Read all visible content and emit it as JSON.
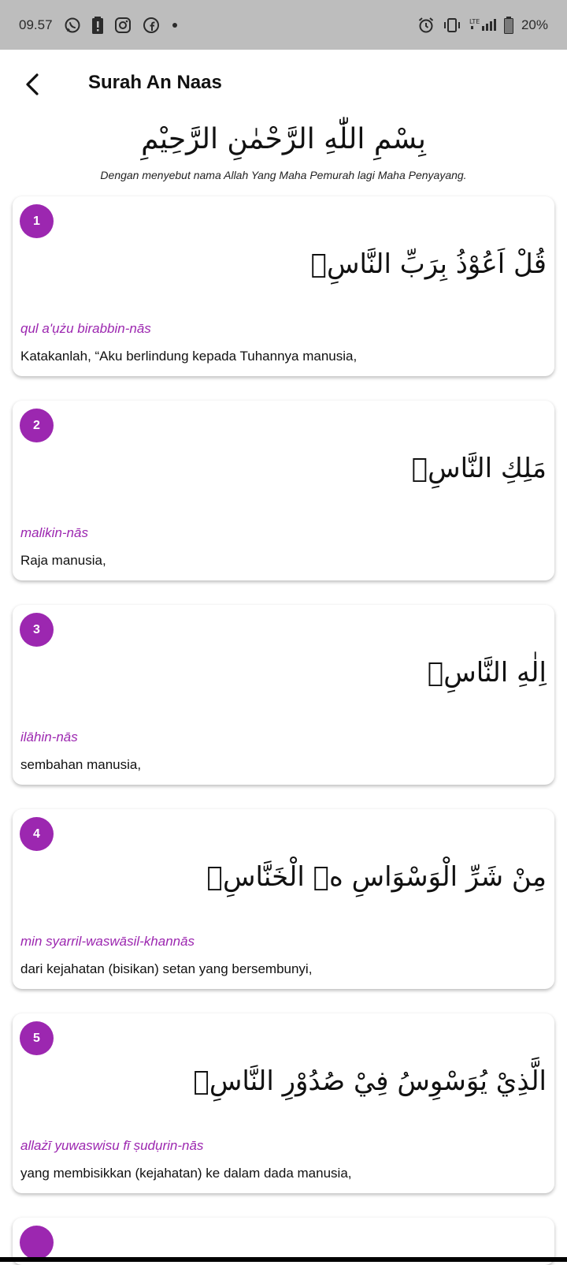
{
  "status_bar": {
    "time": "09.57",
    "battery_percent": "20%",
    "network": "LTE",
    "notification_icons": [
      "whatsapp-icon",
      "battery-alert-icon",
      "instagram-icon",
      "facebook-icon",
      "dot-icon"
    ],
    "system_icons": [
      "alarm-icon",
      "vibrate-icon",
      "signal-icon",
      "battery-icon"
    ]
  },
  "header": {
    "title": "Surah An Naas"
  },
  "bismillah": {
    "arabic": "بِسْمِ اللّٰهِ الرَّحْمٰنِ الرَّحِيْمِ",
    "translation": "Dengan menyebut nama Allah Yang Maha Pemurah lagi Maha Penyayang."
  },
  "verses": [
    {
      "number": "1",
      "arabic": "قُلْ اَعُوْذُ بِرَبِّ النَّاسِۙ",
      "latin": "qul a'ụżu birabbin-nās",
      "translation": "Katakanlah, “Aku berlindung kepada Tuhannya manusia,"
    },
    {
      "number": "2",
      "arabic": "مَلِكِ النَّاسِۙ",
      "latin": "malikin-nās",
      "translation": "Raja manusia,"
    },
    {
      "number": "3",
      "arabic": "اِلٰهِ النَّاسِۙ",
      "latin": "ilāhin-nās",
      "translation": "sembahan manusia,"
    },
    {
      "number": "4",
      "arabic": "مِنْ شَرِّ الْوَسْوَاسِ ەۙ الْخَنَّاسِۖ",
      "latin": "min syarril-waswāsil-khannās",
      "translation": "dari kejahatan (bisikan) setan yang bersembunyi,"
    },
    {
      "number": "5",
      "arabic": "الَّذِيْ يُوَسْوِسُ فِيْ صُدُوْرِ النَّاسِۙ",
      "latin": "allażī yuwaswisu fī ṣudụrin-nās",
      "translation": "yang membisikkan (kejahatan) ke dalam dada manusia,"
    }
  ],
  "colors": {
    "accent": "#9c27b0",
    "status_bar_bg": "#bdbdbd",
    "card_bg": "#ffffff"
  }
}
